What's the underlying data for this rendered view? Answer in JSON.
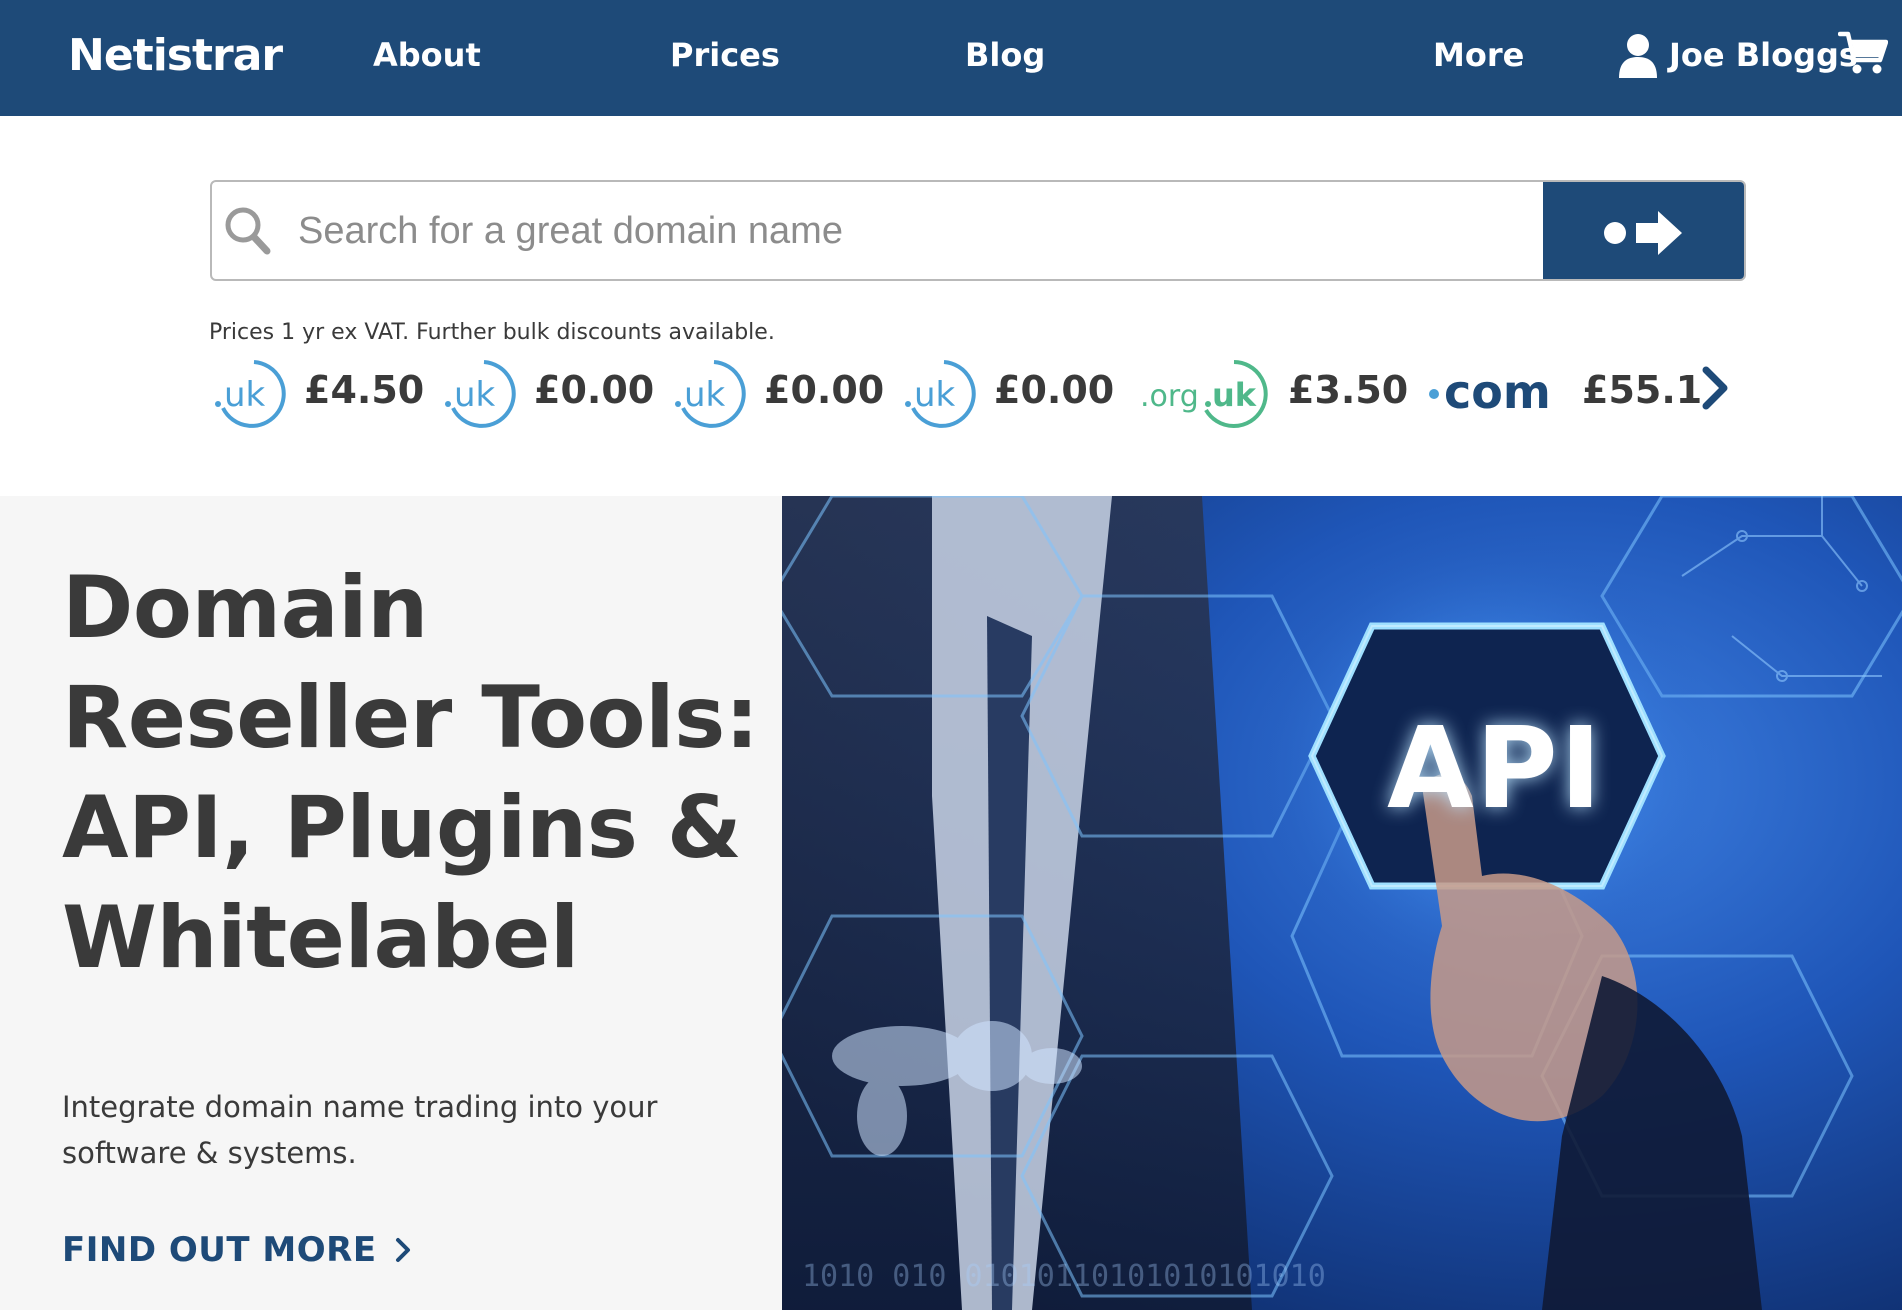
{
  "nav": {
    "logo": "Netistrar",
    "about": "About",
    "prices": "Prices",
    "blog": "Blog",
    "more": "More",
    "user_name": "Joe Bloggs"
  },
  "search": {
    "placeholder": "Search for a great domain name"
  },
  "prices": {
    "note": "Prices 1 yr ex VAT. Further bulk discounts available.",
    "items": [
      {
        "tld": ".uk",
        "amount": "£4.50"
      },
      {
        "tld": ".uk",
        "amount": "£0.00"
      },
      {
        "tld": ".uk",
        "amount": "£0.00"
      },
      {
        "tld": ".uk",
        "amount": "£0.00"
      },
      {
        "tld": ".org.uk",
        "amount": "£3.50"
      },
      {
        "tld": ".com",
        "amount": "£55.1"
      }
    ]
  },
  "hero": {
    "title_lines": [
      "Domain",
      "Reseller Tools:",
      "API, Plugins &",
      "Whitelabel"
    ],
    "description": "Integrate domain name trading into your software & systems.",
    "cta": "FIND OUT MORE",
    "image_text": "API"
  },
  "colors": {
    "brand": "#1e4a78",
    "uk_badge": "#4a9fd6",
    "org_badge": "#4fb88a",
    "hero_bg": "#f6f6f6"
  },
  "icons": {
    "user": "user-icon",
    "cart": "cart-icon",
    "search": "search-icon",
    "go": "dot-arrow-icon",
    "next": "chevron-right-icon"
  }
}
